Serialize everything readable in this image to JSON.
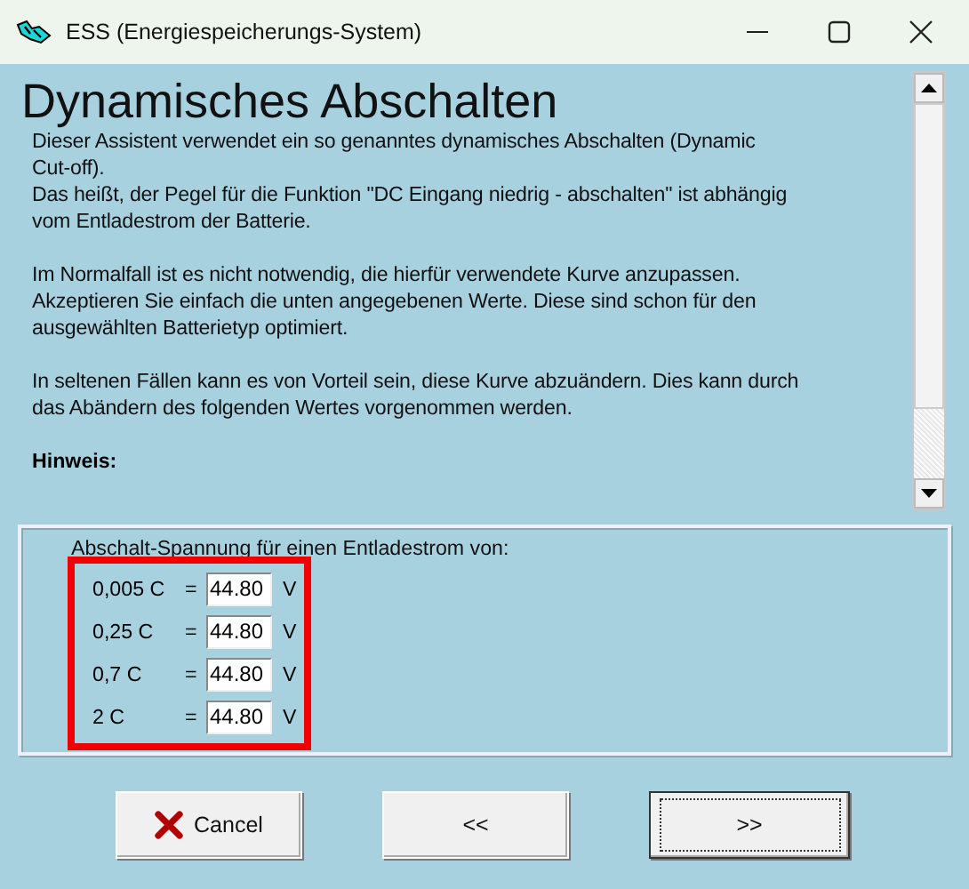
{
  "window": {
    "title": "ESS (Energiespeicherungs-System)"
  },
  "page": {
    "heading": "Dynamisches Abschalten",
    "paragraphs": [
      "Dieser Assistent verwendet ein so genanntes dynamisches Abschalten (Dynamic\nCut-off).\nDas heißt, der Pegel für die Funktion \"DC Eingang niedrig - abschalten\" ist abhängig\nvom Entladestrom der Batterie.",
      "Im Normalfall ist es nicht notwendig, die hierfür verwendete Kurve anzupassen.\nAkzeptieren Sie einfach die unten angegebenen Werte. Diese sind schon für den\nausgewählten Batterietyp optimiert.",
      "In seltenen Fällen kann es von Vorteil sein, diese Kurve abzuändern. Dies kann durch\ndas Abändern des folgenden Wertes vorgenommen werden."
    ],
    "note_heading": "Hinweis:"
  },
  "group": {
    "label": "Abschalt-Spannung für einen Entladestrom von:",
    "rows": [
      {
        "current": "0,005 C",
        "equals": "=",
        "value": "44.80",
        "unit": "V"
      },
      {
        "current": "0,25 C",
        "equals": "=",
        "value": "44.80",
        "unit": "V"
      },
      {
        "current": "0,7 C",
        "equals": "=",
        "value": "44.80",
        "unit": "V"
      },
      {
        "current": "2 C",
        "equals": "=",
        "value": "44.80",
        "unit": "V"
      }
    ]
  },
  "buttons": [
    {
      "label": "Cancel",
      "kind": "cancel",
      "focused": false
    },
    {
      "label": "<<",
      "kind": "back",
      "focused": false
    },
    {
      "label": ">>",
      "kind": "next",
      "focused": true
    }
  ]
}
